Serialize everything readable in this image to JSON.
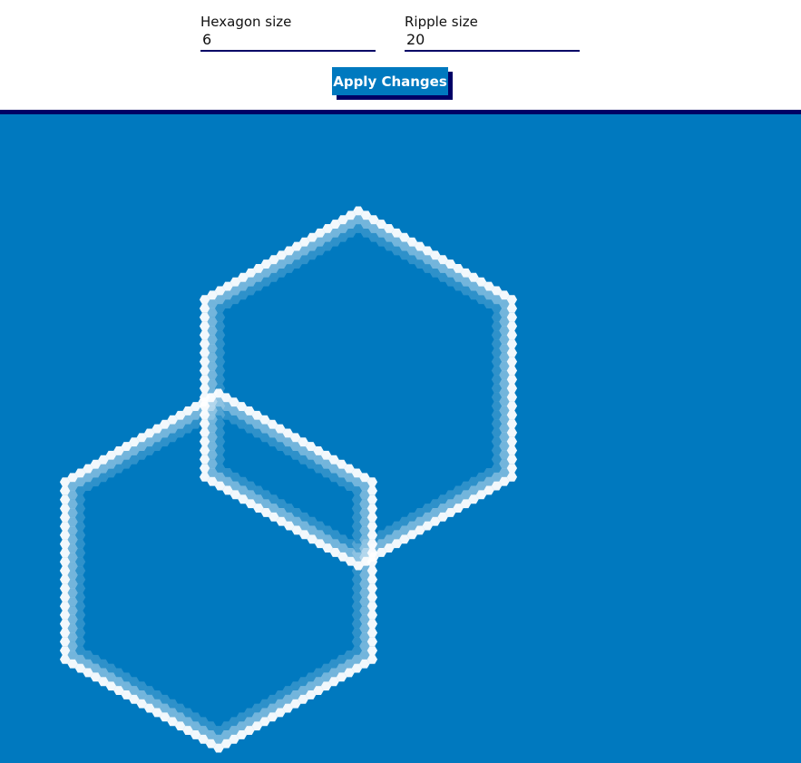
{
  "controls": {
    "hexagon_size_label": "Hexagon size",
    "hexagon_size_value": "6",
    "ripple_size_label": "Ripple size",
    "ripple_size_value": "20",
    "apply_label": "Apply Changes"
  },
  "colors": {
    "background": "#0079bf",
    "accent": "#000066",
    "hexagon": "#ffffff"
  }
}
